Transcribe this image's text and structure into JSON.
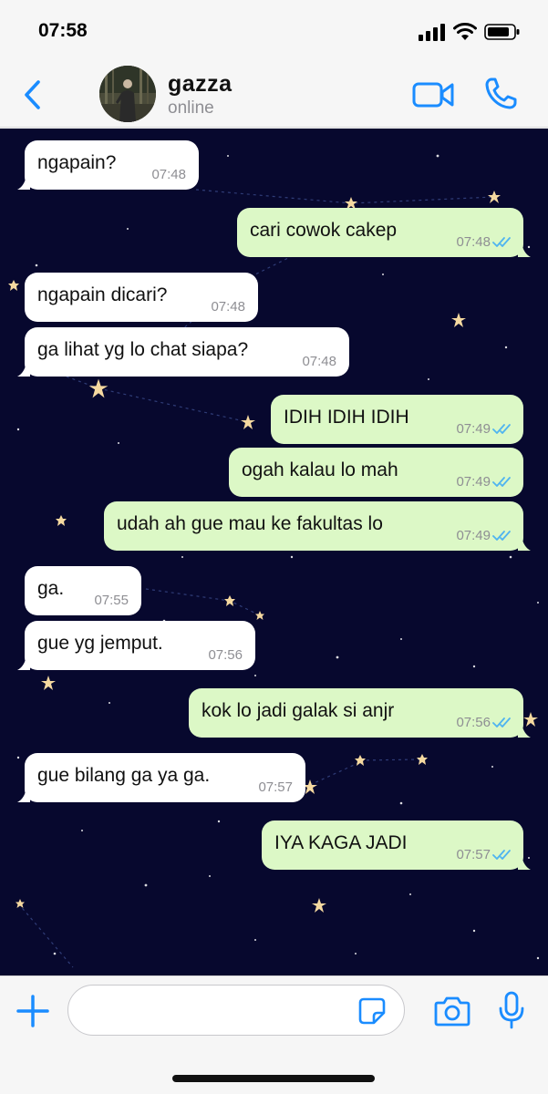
{
  "status_bar": {
    "time": "07:58",
    "icons": [
      "signal-icon",
      "wifi-icon",
      "battery-icon"
    ]
  },
  "header": {
    "contact_name": "gazza",
    "contact_status": "online",
    "icons": [
      "back-chevron-icon",
      "avatar",
      "video-call-icon",
      "phone-call-icon"
    ]
  },
  "messages": [
    {
      "direction": "in",
      "text": "ngapain?",
      "time": "07:48"
    },
    {
      "direction": "out",
      "text": "cari cowok cakep",
      "time": "07:48",
      "read": true
    },
    {
      "direction": "in",
      "text": "ngapain dicari?",
      "time": "07:48"
    },
    {
      "direction": "in",
      "text": "ga lihat yg lo chat siapa?",
      "time": "07:48"
    },
    {
      "direction": "out",
      "text": "IDIH IDIH IDIH",
      "time": "07:49",
      "read": true
    },
    {
      "direction": "out",
      "text": "ogah kalau lo mah",
      "time": "07:49",
      "read": true
    },
    {
      "direction": "out",
      "text": "udah ah gue mau ke fakultas lo",
      "time": "07:49",
      "read": true
    },
    {
      "direction": "in",
      "text": "ga.",
      "time": "07:55"
    },
    {
      "direction": "in",
      "text": "gue yg jemput.",
      "time": "07:56"
    },
    {
      "direction": "out",
      "text": "kok lo jadi galak si anjr",
      "time": "07:56",
      "read": true
    },
    {
      "direction": "in",
      "text": "gue bilang ga ya ga.",
      "time": "07:57"
    },
    {
      "direction": "out",
      "text": "IYA KAGA JADI",
      "time": "07:57",
      "read": true
    }
  ],
  "input_bar": {
    "placeholder": "",
    "icons": [
      "plus-icon",
      "sticker-icon",
      "camera-icon",
      "microphone-icon"
    ]
  },
  "colors": {
    "accent": "#1a8cff",
    "incoming_bubble": "#ffffff",
    "outgoing_bubble": "#dcf8c6",
    "chat_background": "#07082e",
    "read_ticks": "#4fb4f0"
  }
}
